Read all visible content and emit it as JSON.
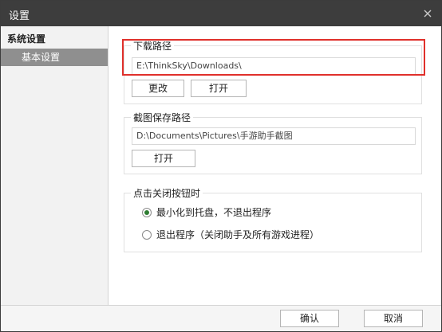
{
  "window": {
    "title": "设置"
  },
  "sidebar": {
    "group_label": "系统设置",
    "items": [
      {
        "label": "基本设置",
        "selected": true
      }
    ]
  },
  "download": {
    "legend": "下载路径",
    "path": "E:\\ThinkSky\\Downloads\\",
    "change_label": "更改",
    "open_label": "打开"
  },
  "screenshot": {
    "legend": "截图保存路径",
    "path": "D:\\Documents\\Pictures\\手游助手截图",
    "open_label": "打开"
  },
  "close_action": {
    "legend": "点击关闭按钮时",
    "options": [
      {
        "label": "最小化到托盘，不退出程序",
        "checked": true
      },
      {
        "label": "退出程序（关闭助手及所有游戏进程）",
        "checked": false
      }
    ]
  },
  "footer": {
    "confirm_label": "确认",
    "cancel_label": "取消"
  },
  "colors": {
    "titlebar": "#3d3d3d",
    "selected_item": "#8f8f8f",
    "highlight": "#e0302b",
    "radio_dot": "#2e7d32"
  },
  "icons": {
    "close": "close-icon"
  }
}
